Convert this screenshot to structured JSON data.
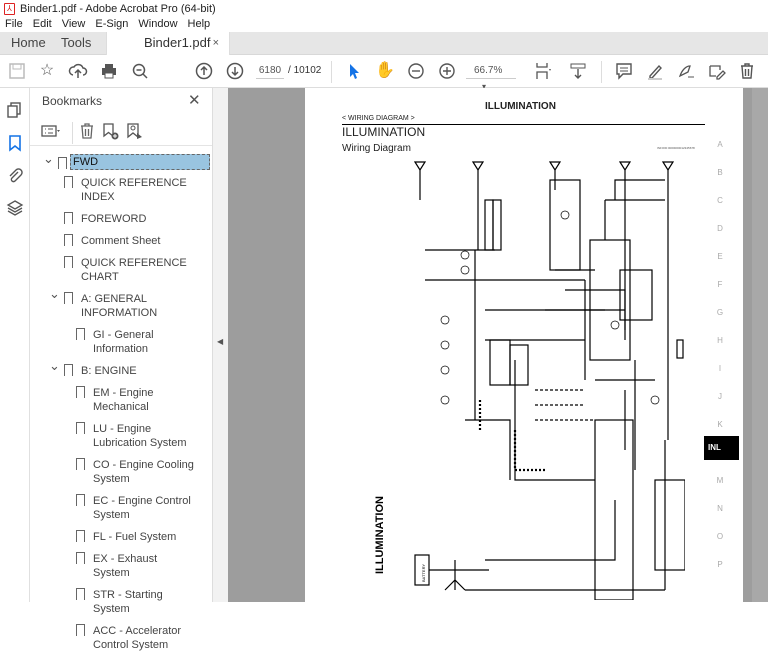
{
  "window": {
    "title": "Binder1.pdf - Adobe Acrobat Pro (64-bit)"
  },
  "menu": [
    "File",
    "Edit",
    "View",
    "E-Sign",
    "Window",
    "Help"
  ],
  "tabs": {
    "home": "Home",
    "tools": "Tools",
    "document": "Binder1.pdf",
    "close": "×"
  },
  "toolbar": {
    "page_current": "6180",
    "page_separator": "/",
    "page_total": "10102",
    "zoom": "66.7%",
    "zoom_arrow": "▾"
  },
  "bookmarks": {
    "title": "Bookmarks",
    "close": "✕",
    "items": [
      {
        "label": "FWD",
        "level": 0,
        "expanded": true,
        "selected": true
      },
      {
        "label": "QUICK REFERENCE INDEX",
        "level": 1
      },
      {
        "label": "FOREWORD",
        "level": 1
      },
      {
        "label": "Comment Sheet",
        "level": 1
      },
      {
        "label": "QUICK REFERENCE CHART",
        "level": 1
      },
      {
        "label": "A: GENERAL INFORMATION",
        "level": 1,
        "expanded": true
      },
      {
        "label": "GI - General Information",
        "level": 2
      },
      {
        "label": "B: ENGINE",
        "level": 1,
        "expanded": true
      },
      {
        "label": "EM - Engine Mechanical",
        "level": 2
      },
      {
        "label": "LU - Engine Lubrication System",
        "level": 2
      },
      {
        "label": "CO - Engine Cooling System",
        "level": 2
      },
      {
        "label": "EC - Engine Control System",
        "level": 2
      },
      {
        "label": "FL - Fuel System",
        "level": 2
      },
      {
        "label": "EX - Exhaust System",
        "level": 2
      },
      {
        "label": "STR - Starting System",
        "level": 2
      },
      {
        "label": "ACC - Accelerator Control System",
        "level": 2
      }
    ]
  },
  "page": {
    "header": "ILLUMINATION",
    "breadcrumb": "< WIRING DIAGRAM >",
    "title": "ILLUMINATION",
    "subtitle": "Wiring Diagram",
    "code": "INFOID:0000000012345678",
    "side_letters": [
      "A",
      "B",
      "C",
      "D",
      "E",
      "F",
      "G",
      "H",
      "I",
      "J",
      "K",
      "M",
      "N",
      "O",
      "P"
    ],
    "side_tab": "INL",
    "diagram_label": "ILLUMINATION",
    "battery_label": "BATTERY"
  },
  "colors": {
    "accent": "#1473e6",
    "selection": "#99c4e0",
    "doc_bg": "#9d9d9d"
  }
}
